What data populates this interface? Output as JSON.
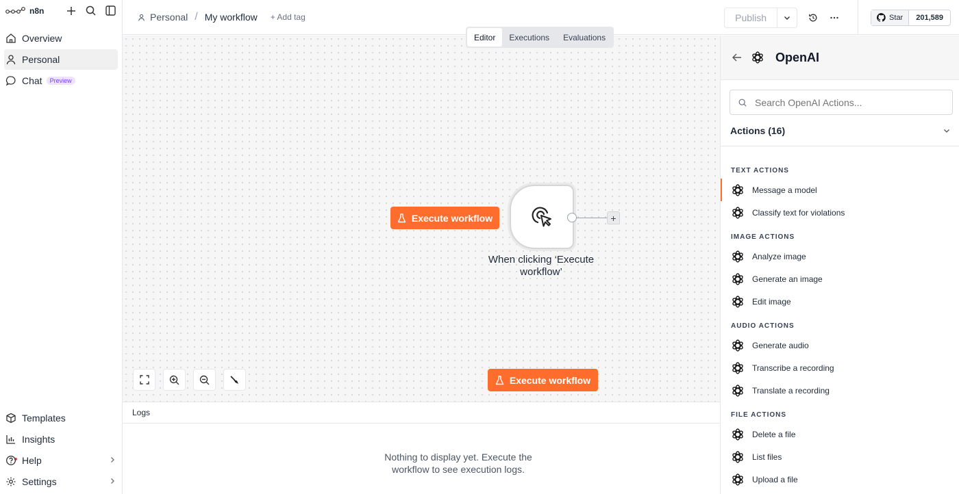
{
  "app": {
    "logo_text": "n8n"
  },
  "sidebar": {
    "items": [
      {
        "label": "Overview"
      },
      {
        "label": "Personal"
      },
      {
        "label": "Chat",
        "badge": "Preview"
      }
    ],
    "bottom_items": [
      {
        "label": "Templates"
      },
      {
        "label": "Insights"
      },
      {
        "label": "Help"
      },
      {
        "label": "Settings"
      }
    ]
  },
  "header": {
    "breadcrumb_project": "Personal",
    "breadcrumb_sep": "/",
    "workflow_name": "My workflow",
    "add_tag": "+ Add tag",
    "publish_label": "Publish",
    "github_star": "Star",
    "github_count": "201,589"
  },
  "canvas": {
    "tabs": [
      {
        "label": "Editor",
        "active": true
      },
      {
        "label": "Executions"
      },
      {
        "label": "Evaluations"
      }
    ],
    "execute_label": "Execute workflow",
    "node_label": "When clicking ‘Execute workflow’",
    "add_node_symbol": "+"
  },
  "logs": {
    "title": "Logs",
    "empty_message": "Nothing to display yet. Execute the workflow to see execution logs."
  },
  "panel": {
    "title": "OpenAI",
    "search_placeholder": "Search OpenAI Actions...",
    "actions_header": "Actions (16)",
    "groups": [
      {
        "title": "TEXT ACTIONS",
        "items": [
          "Message a model",
          "Classify text for violations"
        ]
      },
      {
        "title": "IMAGE ACTIONS",
        "items": [
          "Analyze image",
          "Generate an image",
          "Edit image"
        ]
      },
      {
        "title": "AUDIO ACTIONS",
        "items": [
          "Generate audio",
          "Transcribe a recording",
          "Translate a recording"
        ]
      },
      {
        "title": "FILE ACTIONS",
        "items": [
          "Delete a file",
          "List files",
          "Upload a file"
        ]
      }
    ]
  },
  "colors": {
    "accent": "#ff6d2d",
    "badge_purple": "#7c3aed"
  }
}
